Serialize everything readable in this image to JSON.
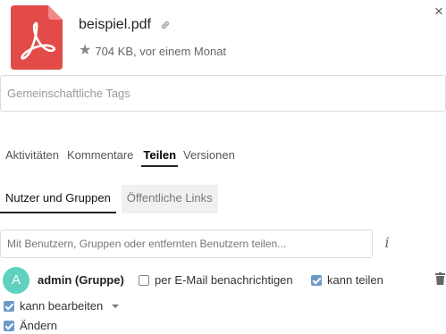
{
  "header": {
    "file_name": "beispiel.pdf",
    "file_meta": "704 KB, vor einem Monat",
    "file_icon": "pdf-icon",
    "file_icon_color": "#e24b47"
  },
  "tags": {
    "placeholder": "Gemeinschaftliche Tags"
  },
  "tabs": [
    {
      "label": "Aktivitäten",
      "active": false
    },
    {
      "label": "Kommentare",
      "active": false
    },
    {
      "label": "Teilen",
      "active": true
    },
    {
      "label": "Versionen",
      "active": false
    }
  ],
  "subtabs": [
    {
      "label": "Nutzer und Gruppen",
      "active": true
    },
    {
      "label": "Öffentliche Links",
      "active": false
    }
  ],
  "share": {
    "placeholder": "Mit Benutzern, Gruppen oder entfernten Benutzern teilen..."
  },
  "share_entry": {
    "avatar_letter": "A",
    "avatar_color": "#5fd1be",
    "name": "admin (Gruppe)",
    "email_notify": {
      "label": "per E-Mail benachrichtigen",
      "checked": false
    },
    "can_share": {
      "label": "kann teilen",
      "checked": true
    },
    "can_edit": {
      "label": "kann bearbeiten",
      "checked": true
    },
    "change": {
      "label": "Ändern",
      "checked": true
    }
  },
  "colors": {
    "checkbox_checked": "#6c9ac9"
  }
}
